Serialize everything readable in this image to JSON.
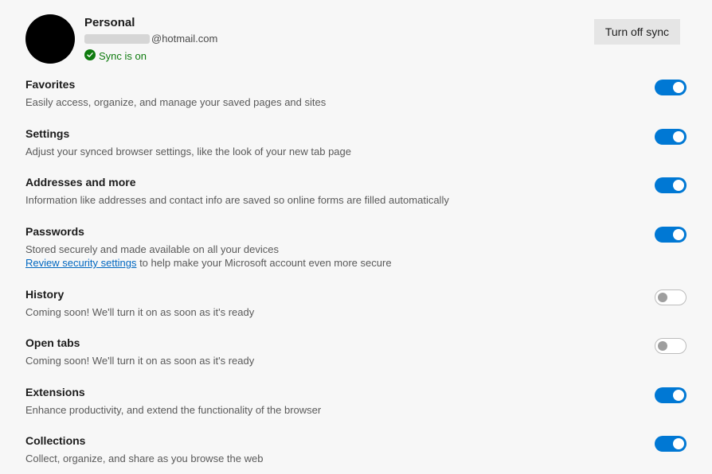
{
  "profile": {
    "name": "Personal",
    "email_domain": "@hotmail.com",
    "sync_status": "Sync is on",
    "turn_off_label": "Turn off sync"
  },
  "items": [
    {
      "key": "favorites",
      "title": "Favorites",
      "desc": "Easily access, organize, and manage your saved pages and sites",
      "enabled": true,
      "interactable": true
    },
    {
      "key": "settings",
      "title": "Settings",
      "desc": "Adjust your synced browser settings, like the look of your new tab page",
      "enabled": true,
      "interactable": true
    },
    {
      "key": "addresses",
      "title": "Addresses and more",
      "desc": "Information like addresses and contact info are saved so online forms are filled automatically",
      "enabled": true,
      "interactable": true
    },
    {
      "key": "passwords",
      "title": "Passwords",
      "desc_pre": "Stored securely and made available on all your devices",
      "link": "Review security settings",
      "desc_post": " to help make your Microsoft account even more secure",
      "enabled": true,
      "interactable": true
    },
    {
      "key": "history",
      "title": "History",
      "desc": "Coming soon! We'll turn it on as soon as it's ready",
      "enabled": false,
      "interactable": false
    },
    {
      "key": "open-tabs",
      "title": "Open tabs",
      "desc": "Coming soon! We'll turn it on as soon as it's ready",
      "enabled": false,
      "interactable": false
    },
    {
      "key": "extensions",
      "title": "Extensions",
      "desc": "Enhance productivity, and extend the functionality of the browser",
      "enabled": true,
      "interactable": true
    },
    {
      "key": "collections",
      "title": "Collections",
      "desc": "Collect, organize, and share as you browse the web",
      "enabled": true,
      "interactable": true
    }
  ]
}
